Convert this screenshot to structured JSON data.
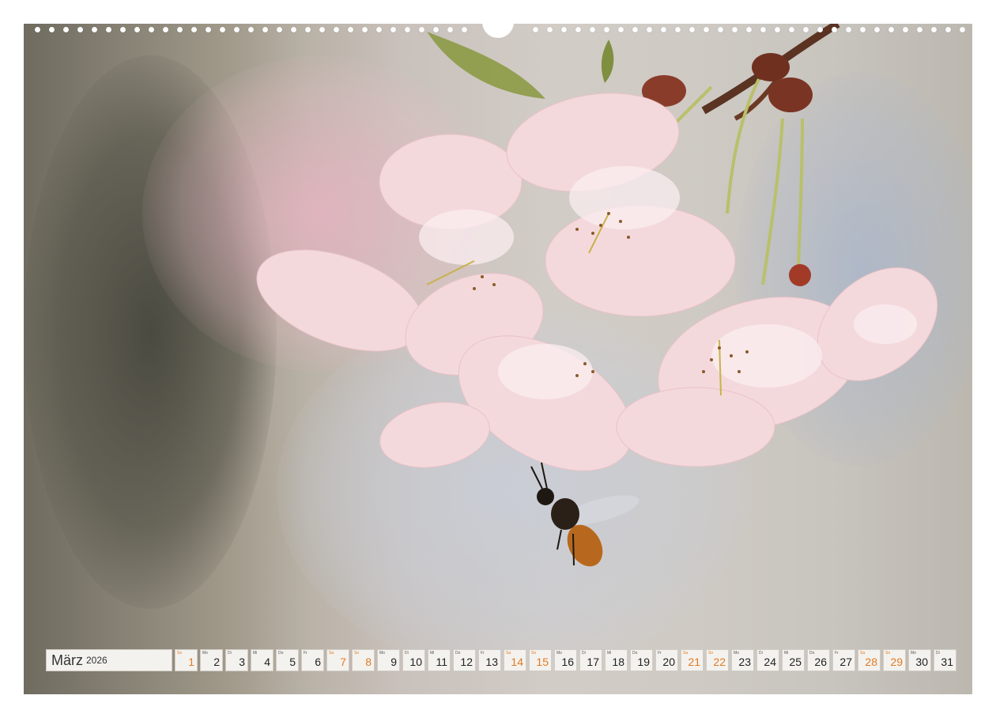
{
  "calendar": {
    "month": "März",
    "year": "2026",
    "days": [
      {
        "num": "1",
        "dow": "So",
        "weekend": true
      },
      {
        "num": "2",
        "dow": "Mo",
        "weekend": false
      },
      {
        "num": "3",
        "dow": "Di",
        "weekend": false
      },
      {
        "num": "4",
        "dow": "Mi",
        "weekend": false
      },
      {
        "num": "5",
        "dow": "Do",
        "weekend": false
      },
      {
        "num": "6",
        "dow": "Fr",
        "weekend": false
      },
      {
        "num": "7",
        "dow": "Sa",
        "weekend": true
      },
      {
        "num": "8",
        "dow": "So",
        "weekend": true
      },
      {
        "num": "9",
        "dow": "Mo",
        "weekend": false
      },
      {
        "num": "10",
        "dow": "Di",
        "weekend": false
      },
      {
        "num": "11",
        "dow": "Mi",
        "weekend": false
      },
      {
        "num": "12",
        "dow": "Do",
        "weekend": false
      },
      {
        "num": "13",
        "dow": "Fr",
        "weekend": false
      },
      {
        "num": "14",
        "dow": "Sa",
        "weekend": true
      },
      {
        "num": "15",
        "dow": "So",
        "weekend": true
      },
      {
        "num": "16",
        "dow": "Mo",
        "weekend": false
      },
      {
        "num": "17",
        "dow": "Di",
        "weekend": false
      },
      {
        "num": "18",
        "dow": "Mi",
        "weekend": false
      },
      {
        "num": "19",
        "dow": "Do",
        "weekend": false
      },
      {
        "num": "20",
        "dow": "Fr",
        "weekend": false
      },
      {
        "num": "21",
        "dow": "Sa",
        "weekend": true
      },
      {
        "num": "22",
        "dow": "So",
        "weekend": true
      },
      {
        "num": "23",
        "dow": "Mo",
        "weekend": false
      },
      {
        "num": "24",
        "dow": "Di",
        "weekend": false
      },
      {
        "num": "25",
        "dow": "Mi",
        "weekend": false
      },
      {
        "num": "26",
        "dow": "Do",
        "weekend": false
      },
      {
        "num": "27",
        "dow": "Fr",
        "weekend": false
      },
      {
        "num": "28",
        "dow": "Sa",
        "weekend": true
      },
      {
        "num": "29",
        "dow": "So",
        "weekend": true
      },
      {
        "num": "30",
        "dow": "Mo",
        "weekend": false
      },
      {
        "num": "31",
        "dow": "Di",
        "weekend": false
      }
    ]
  },
  "colors": {
    "weekend": "#e07b22",
    "weekday": "#222222",
    "cell_bg": "#f4f2ee"
  }
}
